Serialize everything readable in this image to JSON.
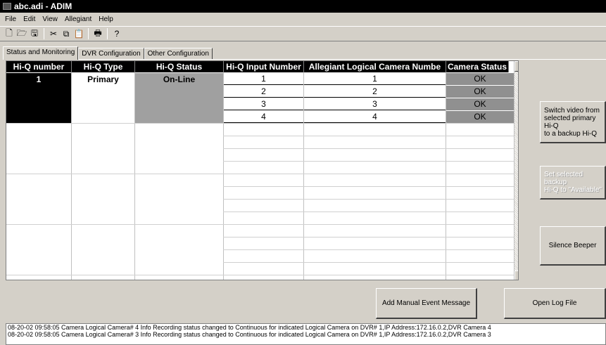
{
  "window": {
    "title": "abc.adi - ADIM"
  },
  "menu": [
    "File",
    "Edit",
    "View",
    "Allegiant",
    "Help"
  ],
  "toolbar": {
    "icons": [
      "new-icon",
      "open-icon",
      "save-icon",
      "cut-icon",
      "copy-icon",
      "paste-icon",
      "print-icon",
      "help-icon"
    ],
    "glyphs": [
      "🗋",
      "🗁",
      "🖫",
      "✂",
      "⧉",
      "📋",
      "🖶",
      "?"
    ]
  },
  "tabs": [
    "Status and Monitoring",
    "DVR Configuration",
    "Other Configuration"
  ],
  "table": {
    "headers": [
      "Hi-Q number",
      "Hi-Q Type",
      "Hi-Q Status",
      "Hi-Q Input Number",
      "Allegiant Logical Camera Numbe",
      "Camera Status"
    ],
    "hiq_number": "1",
    "hiq_type": "Primary",
    "hiq_status": "On-Line",
    "rows": [
      {
        "input": "1",
        "camera": "1",
        "status": "OK"
      },
      {
        "input": "2",
        "camera": "2",
        "status": "OK"
      },
      {
        "input": "3",
        "camera": "3",
        "status": "OK"
      },
      {
        "input": "4",
        "camera": "4",
        "status": "OK"
      }
    ]
  },
  "buttons": {
    "switch_video": "Switch video from\nselected primary Hi-Q\nto a backup Hi-Q",
    "set_available": "Set selected backup\nHi-Q to \"Available\"",
    "silence_beeper": "Silence Beeper",
    "add_event": "Add Manual Event Message",
    "open_log": "Open Log File"
  },
  "log": [
    "08-20-02  09:58:05  Camera  Logical Camera# 4  Info  Recording status changed to Continuous for indicated Logical Camera on DVR# 1,IP Address:172.16.0.2,DVR Camera 4",
    "08-20-02  09:58:05  Camera  Logical Camera# 3  Info  Recording status changed to Continuous for indicated Logical Camera on DVR# 1,IP Address:172.16.0.2,DVR Camera 3"
  ],
  "colors": {
    "selected_row": "#000000",
    "status_cell": "#a0a0a0",
    "ok_cell": "#909090"
  }
}
